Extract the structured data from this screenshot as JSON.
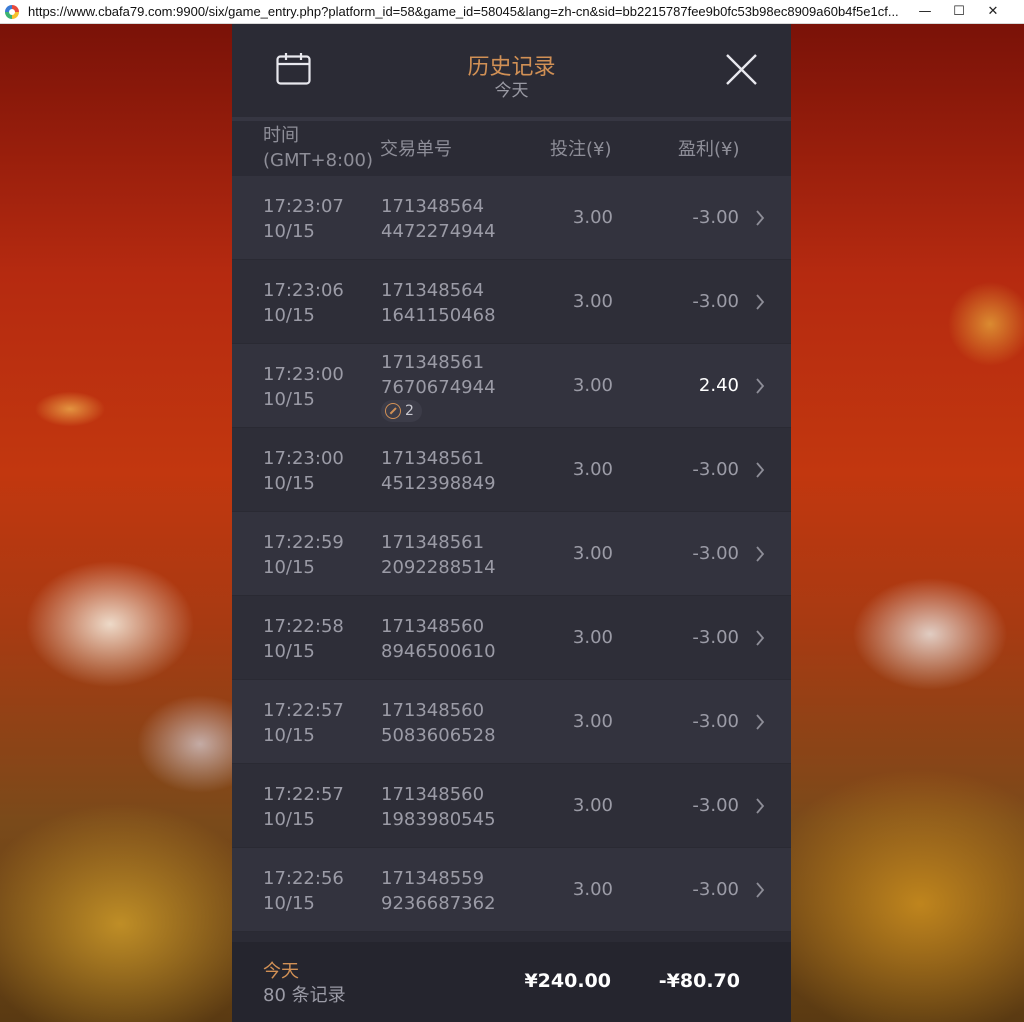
{
  "browser": {
    "url": "https://www.cbafa79.com:9900/six/game_entry.php?platform_id=58&game_id=58045&lang=zh-cn&sid=bb2215787fee9b0fc53b98ec8909a60b4f5e1cf...",
    "minimize": "—",
    "maximize": "☐",
    "close": "✕"
  },
  "header": {
    "title": "历史记录",
    "subtitle": "今天",
    "calendar_icon": "calendar-icon",
    "close_icon": "close-icon"
  },
  "columns": {
    "time_line1": "时间",
    "time_line2": "(GMT+8:00)",
    "transaction": "交易单号",
    "bet": "投注(¥)",
    "profit": "盈利(¥)"
  },
  "rows": [
    {
      "time": "17:23:07",
      "date": "10/15",
      "tx1": "171348564",
      "tx2": "4472274944",
      "bet": "3.00",
      "profit": "-3.00"
    },
    {
      "time": "17:23:06",
      "date": "10/15",
      "tx1": "171348564",
      "tx2": "1641150468",
      "bet": "3.00",
      "profit": "-3.00"
    },
    {
      "time": "17:23:00",
      "date": "10/15",
      "tx1": "171348561",
      "tx2": "7670674944",
      "bet": "3.00",
      "profit": "2.40",
      "badge": "2"
    },
    {
      "time": "17:23:00",
      "date": "10/15",
      "tx1": "171348561",
      "tx2": "4512398849",
      "bet": "3.00",
      "profit": "-3.00"
    },
    {
      "time": "17:22:59",
      "date": "10/15",
      "tx1": "171348561",
      "tx2": "2092288514",
      "bet": "3.00",
      "profit": "-3.00"
    },
    {
      "time": "17:22:58",
      "date": "10/15",
      "tx1": "171348560",
      "tx2": "8946500610",
      "bet": "3.00",
      "profit": "-3.00"
    },
    {
      "time": "17:22:57",
      "date": "10/15",
      "tx1": "171348560",
      "tx2": "5083606528",
      "bet": "3.00",
      "profit": "-3.00"
    },
    {
      "time": "17:22:57",
      "date": "10/15",
      "tx1": "171348560",
      "tx2": "1983980545",
      "bet": "3.00",
      "profit": "-3.00"
    },
    {
      "time": "17:22:56",
      "date": "10/15",
      "tx1": "171348559",
      "tx2": "9236687362",
      "bet": "3.00",
      "profit": "-3.00"
    }
  ],
  "footer": {
    "today": "今天",
    "count": "80 条记录",
    "total_bet": "¥240.00",
    "total_profit": "-¥80.70"
  },
  "colors": {
    "accent": "#d19055",
    "panel": "#2b2b35",
    "text_muted": "#9b9ba6"
  }
}
